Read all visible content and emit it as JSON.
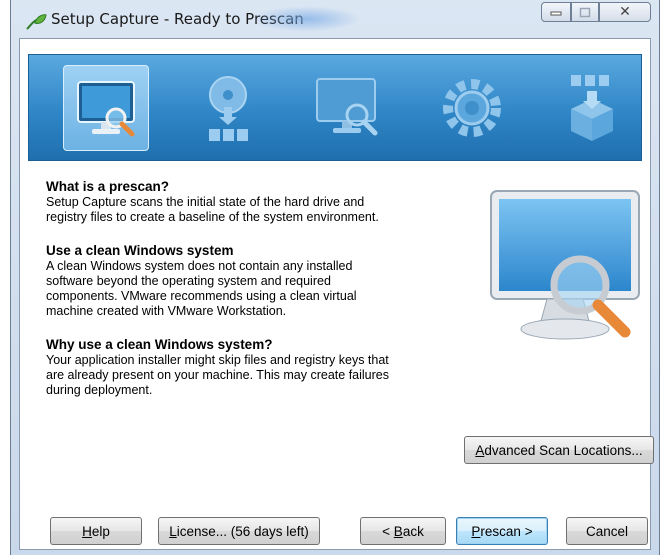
{
  "window": {
    "title": "Setup Capture - Ready to Prescan"
  },
  "banner": {
    "steps": [
      {
        "icon": "prescan-monitor-icon",
        "active": true
      },
      {
        "icon": "install-disc-icon",
        "active": false
      },
      {
        "icon": "postscan-monitor-icon",
        "active": false
      },
      {
        "icon": "configure-gear-icon",
        "active": false
      },
      {
        "icon": "build-package-icon",
        "active": false
      }
    ]
  },
  "sections": [
    {
      "title": "What is a prescan?",
      "lines": [
        "Setup Capture scans the initial state of the hard drive and",
        "registry files to create a baseline of the system environment."
      ]
    },
    {
      "title": "Use a clean Windows system",
      "lines": [
        "A clean Windows system does not contain any installed",
        "software beyond the operating system and required",
        "components. VMware recommends using a clean virtual",
        "machine created with VMware Workstation."
      ]
    },
    {
      "title": "Why use a clean Windows system?",
      "lines": [
        "Your application installer might skip files and registry keys that",
        "are already present on your machine. This may create failures",
        "during deployment."
      ]
    }
  ],
  "buttons": {
    "advanced": {
      "accel": "A",
      "rest": "dvanced Scan Locations..."
    },
    "help": {
      "accel": "H",
      "rest": "elp"
    },
    "license": {
      "accel": "L",
      "rest": "icense... (56 days left)"
    },
    "back": {
      "prefix": "< ",
      "accel": "B",
      "rest": "ack"
    },
    "prescan": {
      "accel": "P",
      "rest": "rescan >"
    },
    "cancel": {
      "label": "Cancel"
    }
  },
  "colors": {
    "banner_top": "#5aa8df",
    "banner_bottom": "#1f6fae",
    "default_button_border": "#3c7fb1"
  }
}
